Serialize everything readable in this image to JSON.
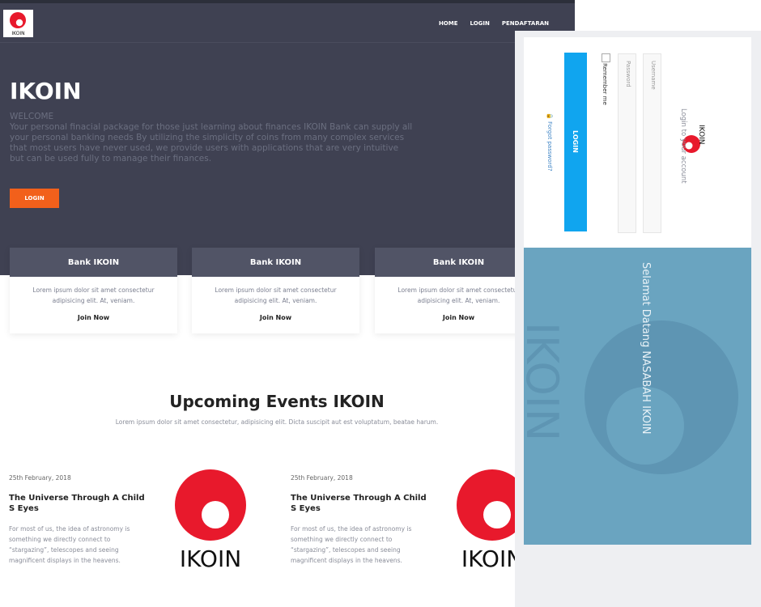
{
  "nav": {
    "items": [
      "HOME",
      "LOGIN",
      "PENDAFTARAN"
    ],
    "logo_text": "IKOIN"
  },
  "hero": {
    "title": "IKOIN",
    "welcome": "WELCOME",
    "description": "Your personal finacial package for those just learning about finances IKOIN Bank can supply all your personal banking needs By utilizing the simplicity of coins from many complex services that most users have never used, we provide users with applications that are very intuitive but can be used fully to manage their finances.",
    "button": "LOGIN"
  },
  "cards": [
    {
      "title": "Bank IKOIN",
      "text": "Lorem ipsum dolor sit amet consectetur adipisicing elit. At, veniam.",
      "link": "Join Now"
    },
    {
      "title": "Bank IKOIN",
      "text": "Lorem ipsum dolor sit amet consectetur adipisicing elit. At, veniam.",
      "link": "Join Now"
    },
    {
      "title": "Bank IKOIN",
      "text": "Lorem ipsum dolor sit amet consectetur adipisicing elit. At, veniam.",
      "link": "Join Now"
    }
  ],
  "events": {
    "title": "Upcoming Events IKOIN",
    "subtitle": "Lorem ipsum dolor sit amet consectetur, adipisicing elit. Dicta suscipit aut est voluptatum, beatae harum.",
    "items": [
      {
        "date": "25th February, 2018",
        "title": "The Universe Through A Child S Eyes",
        "text": "For most of us, the idea of astronomy is something we directly connect to “stargazing”, telescopes and seeing magnificent displays in the heavens.",
        "logo_text": "IKOIN"
      },
      {
        "date": "25th February, 2018",
        "title": "The Universe Through A Child S Eyes",
        "text": "For most of us, the idea of astronomy is something we directly connect to “stargazing”, telescopes and seeing magnificent displays in the heavens.",
        "logo_text": "IKOIN"
      }
    ]
  },
  "login": {
    "logo_text": "IKOIN",
    "heading": "Login to your account",
    "username_placeholder": "Username",
    "password_placeholder": "Password",
    "remember": "Remember me",
    "button": "LOGIN",
    "forgot": "Forgot password?",
    "welcome": "Selamat Datang NASABAH IKOIN",
    "watermark": "IKOIN"
  },
  "colors": {
    "hero_bg": "#3f4152",
    "accent": "#f2601b",
    "logo_red": "#e8192c",
    "login_blue": "#10a5ef",
    "panel_blue": "#6aa4c0"
  }
}
